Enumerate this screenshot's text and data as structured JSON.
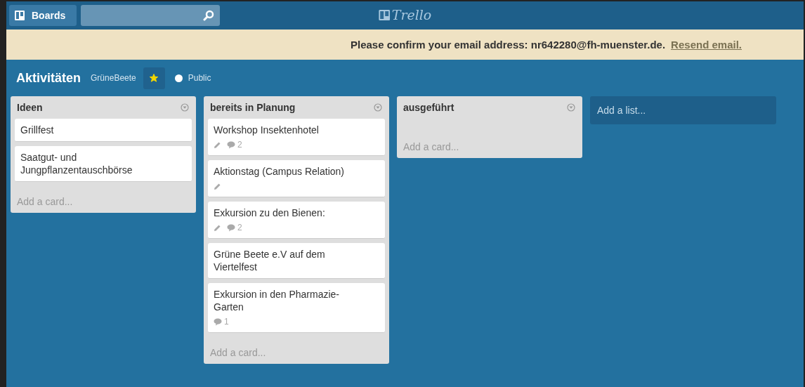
{
  "header": {
    "boards_button": "Boards",
    "logo": "Trello"
  },
  "banner": {
    "message": "Please confirm your email address: nr642280@fh-muenster.de.",
    "link": "Resend email."
  },
  "board": {
    "title": "Aktivitäten",
    "team": "GrüneBeete",
    "starred": true,
    "visibility": "Public"
  },
  "lists": [
    {
      "title": "Ideen",
      "cards": [
        {
          "title": "Grillfest"
        },
        {
          "title": "Saatgut- und Jungpflanzentauschbörse"
        }
      ],
      "add_card": "Add a card..."
    },
    {
      "title": "bereits in Planung",
      "cards": [
        {
          "title": "Workshop Insektenhotel",
          "badges": [
            {
              "kind": "description"
            },
            {
              "kind": "comments",
              "count": "2"
            }
          ]
        },
        {
          "title": "Aktionstag (Campus Relation)",
          "badges": [
            {
              "kind": "description"
            }
          ]
        },
        {
          "title": "Exkursion zu den Bienen:",
          "badges": [
            {
              "kind": "description"
            },
            {
              "kind": "comments",
              "count": "2"
            }
          ]
        },
        {
          "title": "Grüne Beete e.V auf dem Viertelfest"
        },
        {
          "title": "Exkursion in den Pharmazie-Garten",
          "badges": [
            {
              "kind": "comments",
              "count": "1"
            }
          ]
        }
      ],
      "add_card": "Add a card..."
    },
    {
      "title": "ausgeführt",
      "add_card": "Add a card..."
    }
  ],
  "add_list": "Add a list..."
}
